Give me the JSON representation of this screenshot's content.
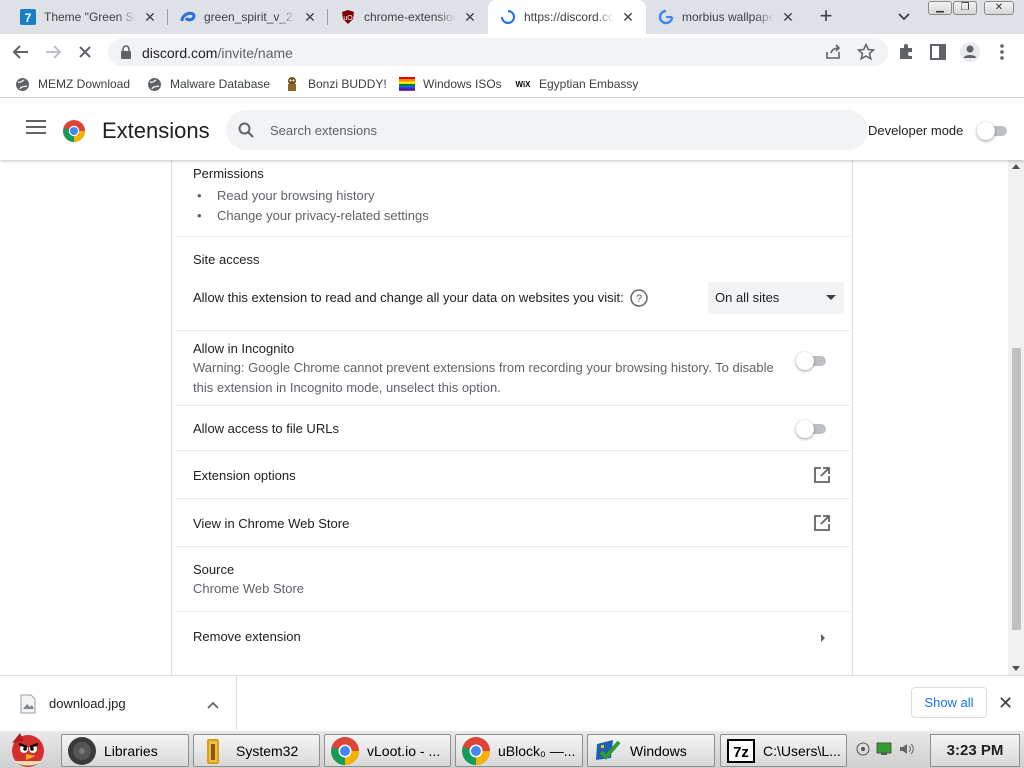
{
  "tabs": [
    {
      "title": "Theme \"Green Sp",
      "icon": "tvtropes-icon"
    },
    {
      "title": "green_spirit_v_2.m",
      "icon": "edge-swirl-icon"
    },
    {
      "title": "chrome-extension",
      "icon": "ublock-shield-icon"
    },
    {
      "title": "https://discord.co",
      "icon": "loading-spinner-icon",
      "active": true
    },
    {
      "title": "morbius wallpape",
      "icon": "google-g-icon"
    }
  ],
  "address_bar": {
    "host": "discord.com",
    "path": "/invite/name"
  },
  "bookmarks": [
    {
      "label": "MEMZ Download",
      "icon": "globe-icon"
    },
    {
      "label": "Malware Database",
      "icon": "globe-icon"
    },
    {
      "label": "Bonzi BUDDY!",
      "icon": "bonzi-icon"
    },
    {
      "label": "Windows ISOs",
      "icon": "windows-flag-icon"
    },
    {
      "label": "Egyptian Embassy",
      "icon": "wix-icon"
    }
  ],
  "header": {
    "title": "Extensions",
    "search_placeholder": "Search extensions",
    "developer_mode_label": "Developer mode",
    "developer_mode_on": false
  },
  "details": {
    "permissions": {
      "heading": "Permissions",
      "items": [
        "Read your browsing history",
        "Change your privacy-related settings"
      ]
    },
    "site_access": {
      "heading": "Site access",
      "description": "Allow this extension to read and change all your data on websites you visit:",
      "selected": "On all sites"
    },
    "incognito": {
      "heading": "Allow in Incognito",
      "warning": "Warning: Google Chrome cannot prevent extensions from recording your browsing history. To disable this extension in Incognito mode, unselect this option.",
      "enabled": false
    },
    "file_urls": {
      "label": "Allow access to file URLs",
      "enabled": false
    },
    "extension_options": {
      "label": "Extension options"
    },
    "web_store": {
      "label": "View in Chrome Web Store"
    },
    "source": {
      "heading": "Source",
      "value": "Chrome Web Store"
    },
    "remove": {
      "label": "Remove extension"
    }
  },
  "downloads": {
    "file_name": "download.jpg",
    "show_all_label": "Show all"
  },
  "taskbar": {
    "items": [
      {
        "label": "Libraries",
        "icon": "libraries-icon"
      },
      {
        "label": "System32",
        "icon": "folder-icon"
      },
      {
        "label": "vLoot.io - ...",
        "icon": "chrome-icon"
      },
      {
        "label": "uBlock₀ —...",
        "icon": "chrome-icon"
      },
      {
        "label": "Windows",
        "icon": "windows-update-icon"
      },
      {
        "label": "C:\\Users\\L...",
        "icon": "sevenzip-icon"
      }
    ],
    "clock": "3:23 PM"
  },
  "colors": {
    "accent_blue": "#1a73e8",
    "toolbar_grey": "#dee1e6",
    "text_secondary": "#5f6368"
  }
}
